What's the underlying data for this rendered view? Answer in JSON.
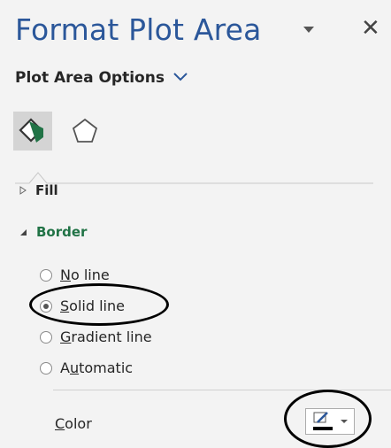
{
  "pane": {
    "title": "Format Plot Area",
    "options_label": "Plot Area Options",
    "icons": [
      "fill-line-icon",
      "effects-icon"
    ]
  },
  "sections": {
    "fill": {
      "label": "Fill",
      "expanded": false
    },
    "border": {
      "label": "Border",
      "expanded": true
    }
  },
  "border_options": [
    {
      "mnemonic": "N",
      "rest": "o line",
      "selected": false
    },
    {
      "mnemonic": "S",
      "rest": "olid line",
      "selected": true
    },
    {
      "mnemonic": "G",
      "rest": "radient line",
      "selected": false
    },
    {
      "pre": "A",
      "mnemonic": "u",
      "rest": "tomatic",
      "selected": false
    }
  ],
  "color": {
    "mnemonic": "C",
    "rest": "olor",
    "swatch": "#000000"
  },
  "colors": {
    "title": "#2b579a",
    "border_label": "#217346",
    "accent_chevron": "#2b579a"
  }
}
